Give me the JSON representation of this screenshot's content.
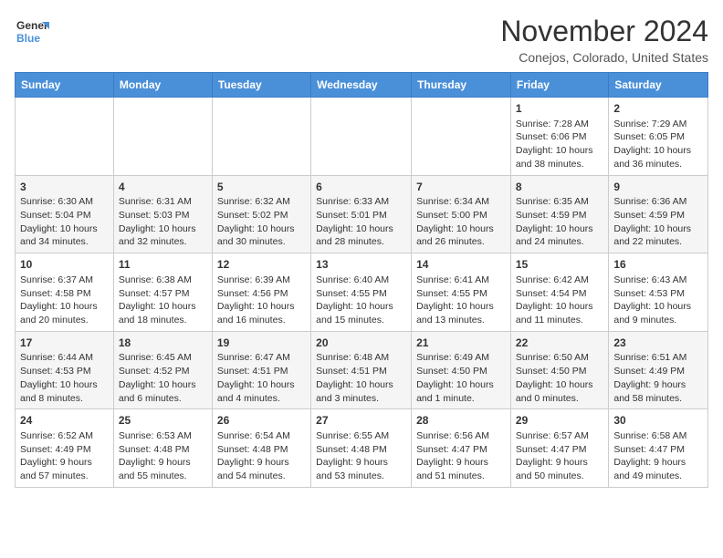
{
  "header": {
    "logo_general": "General",
    "logo_blue": "Blue",
    "month_title": "November 2024",
    "location": "Conejos, Colorado, United States"
  },
  "days_of_week": [
    "Sunday",
    "Monday",
    "Tuesday",
    "Wednesday",
    "Thursday",
    "Friday",
    "Saturday"
  ],
  "weeks": [
    [
      {
        "day": "",
        "sunrise": "",
        "sunset": "",
        "daylight": ""
      },
      {
        "day": "",
        "sunrise": "",
        "sunset": "",
        "daylight": ""
      },
      {
        "day": "",
        "sunrise": "",
        "sunset": "",
        "daylight": ""
      },
      {
        "day": "",
        "sunrise": "",
        "sunset": "",
        "daylight": ""
      },
      {
        "day": "",
        "sunrise": "",
        "sunset": "",
        "daylight": ""
      },
      {
        "day": "1",
        "sunrise": "Sunrise: 7:28 AM",
        "sunset": "Sunset: 6:06 PM",
        "daylight": "Daylight: 10 hours and 38 minutes."
      },
      {
        "day": "2",
        "sunrise": "Sunrise: 7:29 AM",
        "sunset": "Sunset: 6:05 PM",
        "daylight": "Daylight: 10 hours and 36 minutes."
      }
    ],
    [
      {
        "day": "3",
        "sunrise": "Sunrise: 6:30 AM",
        "sunset": "Sunset: 5:04 PM",
        "daylight": "Daylight: 10 hours and 34 minutes."
      },
      {
        "day": "4",
        "sunrise": "Sunrise: 6:31 AM",
        "sunset": "Sunset: 5:03 PM",
        "daylight": "Daylight: 10 hours and 32 minutes."
      },
      {
        "day": "5",
        "sunrise": "Sunrise: 6:32 AM",
        "sunset": "Sunset: 5:02 PM",
        "daylight": "Daylight: 10 hours and 30 minutes."
      },
      {
        "day": "6",
        "sunrise": "Sunrise: 6:33 AM",
        "sunset": "Sunset: 5:01 PM",
        "daylight": "Daylight: 10 hours and 28 minutes."
      },
      {
        "day": "7",
        "sunrise": "Sunrise: 6:34 AM",
        "sunset": "Sunset: 5:00 PM",
        "daylight": "Daylight: 10 hours and 26 minutes."
      },
      {
        "day": "8",
        "sunrise": "Sunrise: 6:35 AM",
        "sunset": "Sunset: 4:59 PM",
        "daylight": "Daylight: 10 hours and 24 minutes."
      },
      {
        "day": "9",
        "sunrise": "Sunrise: 6:36 AM",
        "sunset": "Sunset: 4:59 PM",
        "daylight": "Daylight: 10 hours and 22 minutes."
      }
    ],
    [
      {
        "day": "10",
        "sunrise": "Sunrise: 6:37 AM",
        "sunset": "Sunset: 4:58 PM",
        "daylight": "Daylight: 10 hours and 20 minutes."
      },
      {
        "day": "11",
        "sunrise": "Sunrise: 6:38 AM",
        "sunset": "Sunset: 4:57 PM",
        "daylight": "Daylight: 10 hours and 18 minutes."
      },
      {
        "day": "12",
        "sunrise": "Sunrise: 6:39 AM",
        "sunset": "Sunset: 4:56 PM",
        "daylight": "Daylight: 10 hours and 16 minutes."
      },
      {
        "day": "13",
        "sunrise": "Sunrise: 6:40 AM",
        "sunset": "Sunset: 4:55 PM",
        "daylight": "Daylight: 10 hours and 15 minutes."
      },
      {
        "day": "14",
        "sunrise": "Sunrise: 6:41 AM",
        "sunset": "Sunset: 4:55 PM",
        "daylight": "Daylight: 10 hours and 13 minutes."
      },
      {
        "day": "15",
        "sunrise": "Sunrise: 6:42 AM",
        "sunset": "Sunset: 4:54 PM",
        "daylight": "Daylight: 10 hours and 11 minutes."
      },
      {
        "day": "16",
        "sunrise": "Sunrise: 6:43 AM",
        "sunset": "Sunset: 4:53 PM",
        "daylight": "Daylight: 10 hours and 9 minutes."
      }
    ],
    [
      {
        "day": "17",
        "sunrise": "Sunrise: 6:44 AM",
        "sunset": "Sunset: 4:53 PM",
        "daylight": "Daylight: 10 hours and 8 minutes."
      },
      {
        "day": "18",
        "sunrise": "Sunrise: 6:45 AM",
        "sunset": "Sunset: 4:52 PM",
        "daylight": "Daylight: 10 hours and 6 minutes."
      },
      {
        "day": "19",
        "sunrise": "Sunrise: 6:47 AM",
        "sunset": "Sunset: 4:51 PM",
        "daylight": "Daylight: 10 hours and 4 minutes."
      },
      {
        "day": "20",
        "sunrise": "Sunrise: 6:48 AM",
        "sunset": "Sunset: 4:51 PM",
        "daylight": "Daylight: 10 hours and 3 minutes."
      },
      {
        "day": "21",
        "sunrise": "Sunrise: 6:49 AM",
        "sunset": "Sunset: 4:50 PM",
        "daylight": "Daylight: 10 hours and 1 minute."
      },
      {
        "day": "22",
        "sunrise": "Sunrise: 6:50 AM",
        "sunset": "Sunset: 4:50 PM",
        "daylight": "Daylight: 10 hours and 0 minutes."
      },
      {
        "day": "23",
        "sunrise": "Sunrise: 6:51 AM",
        "sunset": "Sunset: 4:49 PM",
        "daylight": "Daylight: 9 hours and 58 minutes."
      }
    ],
    [
      {
        "day": "24",
        "sunrise": "Sunrise: 6:52 AM",
        "sunset": "Sunset: 4:49 PM",
        "daylight": "Daylight: 9 hours and 57 minutes."
      },
      {
        "day": "25",
        "sunrise": "Sunrise: 6:53 AM",
        "sunset": "Sunset: 4:48 PM",
        "daylight": "Daylight: 9 hours and 55 minutes."
      },
      {
        "day": "26",
        "sunrise": "Sunrise: 6:54 AM",
        "sunset": "Sunset: 4:48 PM",
        "daylight": "Daylight: 9 hours and 54 minutes."
      },
      {
        "day": "27",
        "sunrise": "Sunrise: 6:55 AM",
        "sunset": "Sunset: 4:48 PM",
        "daylight": "Daylight: 9 hours and 53 minutes."
      },
      {
        "day": "28",
        "sunrise": "Sunrise: 6:56 AM",
        "sunset": "Sunset: 4:47 PM",
        "daylight": "Daylight: 9 hours and 51 minutes."
      },
      {
        "day": "29",
        "sunrise": "Sunrise: 6:57 AM",
        "sunset": "Sunset: 4:47 PM",
        "daylight": "Daylight: 9 hours and 50 minutes."
      },
      {
        "day": "30",
        "sunrise": "Sunrise: 6:58 AM",
        "sunset": "Sunset: 4:47 PM",
        "daylight": "Daylight: 9 hours and 49 minutes."
      }
    ]
  ]
}
